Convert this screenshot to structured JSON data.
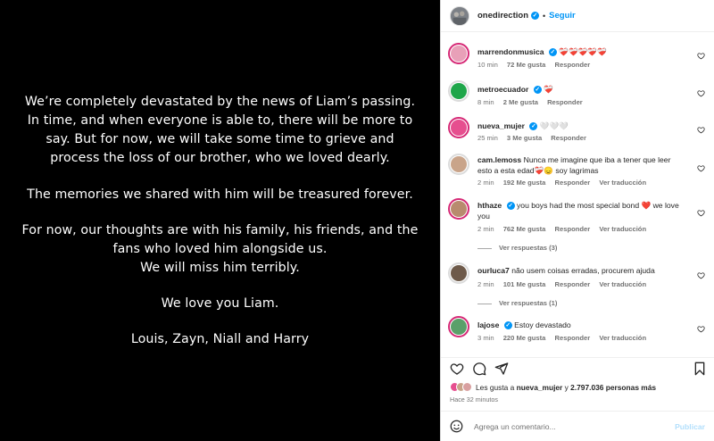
{
  "post": {
    "paragraph_1": [
      "We’re completely devastated by the news of Liam’s passing.",
      "In time, and when everyone is able to, there will be more to",
      "say. But for now, we will take some time to grieve and",
      "process the loss of our brother, who we loved dearly."
    ],
    "paragraph_2": "The memories we shared with him will be treasured forever.",
    "paragraph_3": [
      "For now, our thoughts are with his family, his friends, and the",
      "fans who loved him alongside us.",
      "We will miss him terribly."
    ],
    "paragraph_4": "We love you Liam.",
    "paragraph_5": "Louis, Zayn, Niall and Harry"
  },
  "header": {
    "username": "onedirection",
    "separator": "•",
    "follow_label": "Seguir"
  },
  "comments": [
    {
      "user": "marrendonmusica",
      "text": "❤️‍🩹❤️‍🩹❤️‍🩹❤️‍🩹❤️‍🩹",
      "time": "10 min",
      "likes": "72 Me gusta",
      "reply": "Responder",
      "verified": true,
      "avatar_color": "#e8a0b8"
    },
    {
      "user": "metroecuador",
      "text": "❤️‍🩹",
      "time": "8 min",
      "likes": "2 Me gusta",
      "reply": "Responder",
      "verified": true,
      "avatar_color": "#1fa64a"
    },
    {
      "user": "nueva_mujer",
      "text": "🤍🤍🤍",
      "time": "25 min",
      "likes": "3 Me gusta",
      "reply": "Responder",
      "verified": true,
      "avatar_color": "#e64f8f"
    },
    {
      "user": "cam.lemoss",
      "text": "Nunca me imagine que iba a tener que leer esto a esta edad❤️‍🩹😞 soy lagrimas",
      "time": "2 min",
      "likes": "192 Me gusta",
      "reply": "Responder",
      "translate": "Ver traducción",
      "verified": false,
      "avatar_color": "#c9a48a"
    },
    {
      "user": "hthaze",
      "text": "you boys had the most special bond ❤️ we love you",
      "time": "2 min",
      "likes": "762 Me gusta",
      "reply": "Responder",
      "translate": "Ver traducción",
      "verified": true,
      "avatar_color": "#b88b6e",
      "replies_label": "Ver respuestas (3)"
    },
    {
      "user": "ourluca7",
      "text": "não usem coisas erradas, procurem ajuda",
      "time": "2 min",
      "likes": "101 Me gusta",
      "reply": "Responder",
      "translate": "Ver traducción",
      "verified": false,
      "avatar_color": "#6e5a4a",
      "replies_label": "Ver respuestas (1)"
    },
    {
      "user": "lajose",
      "text": "Estoy devastado",
      "time": "3 min",
      "likes": "220 Me gusta",
      "reply": "Responder",
      "translate": "Ver traducción",
      "verified": true,
      "avatar_color": "#5aa06a"
    }
  ],
  "likes": {
    "prefix": "Les gusta a",
    "user": "nueva_mujer",
    "middle": "y",
    "count": "2.797.036 personas más"
  },
  "time_ago": "Hace 32 minutos",
  "composer": {
    "placeholder": "Agrega un comentario...",
    "post_label": "Publicar"
  },
  "colors": {
    "accent": "#0095f6",
    "verified": "#0095f6",
    "story_ring": "#d62976"
  }
}
